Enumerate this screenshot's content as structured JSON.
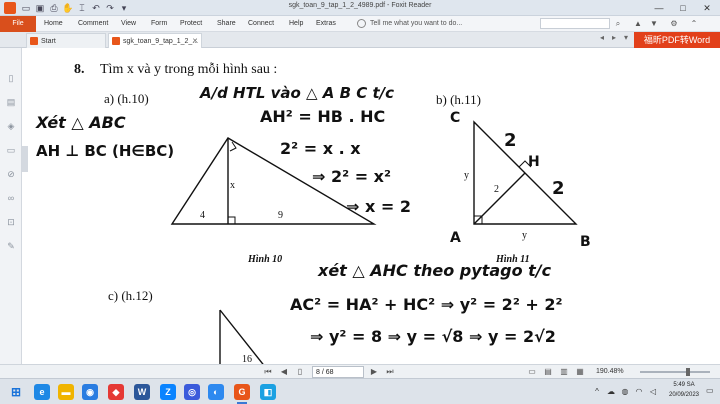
{
  "window": {
    "title": "sgk_toan_9_tap_1_2_4989.pdf - Foxit Reader",
    "minimize": "—",
    "maximize": "□",
    "close": "✕"
  },
  "menu": {
    "file": "File",
    "items": [
      "Home",
      "Comment",
      "View",
      "Form",
      "Protect",
      "Share",
      "Connect",
      "Help",
      "Extras"
    ],
    "tell_me": "Tell me what you want to do..."
  },
  "tabs": [
    {
      "label": "Start"
    },
    {
      "label": "sgk_toan_9_tap_1_2_..."
    }
  ],
  "promo": {
    "label": "福昕PDF转Word"
  },
  "document": {
    "exercise_number": "8.",
    "exercise_text": "Tìm x và y trong mỗi hình sau :",
    "part_a": "a) (h.10)",
    "part_b": "b) (h.11)",
    "part_c": "c) (h.12)",
    "fig10_caption": "Hình 10",
    "fig11_caption": "Hình 11",
    "fig10_labels": {
      "x": "x",
      "left": "4",
      "right": "9"
    },
    "fig11_labels": {
      "y_left": "y",
      "inner": "2",
      "y_bottom": "y"
    },
    "fig12_labels": {
      "value": "16"
    },
    "handwriting": {
      "top_header": "A/d HTL vào △ A B C t/c",
      "left_line1": "Xét △ ABC",
      "left_line2": "AH ⊥ BC (H∈BC)",
      "eq1": "AH² = HB . HC",
      "eq2": "2² = x . x",
      "eq3": "⇒ 2² = x²",
      "eq4": "⇒ x = 2",
      "fig11_C": "C",
      "fig11_H": "H",
      "fig11_A": "A",
      "fig11_B": "B",
      "fig11_two_top": "2",
      "fig11_two_right": "2",
      "mid_header": "xét △ AHC theo pytago t/c",
      "line_a": "AC² = HA² + HC² ⇒ y² = 2² + 2²",
      "line_b": "⇒ y² = 8 ⇒ y = √8 ⇒ y = 2√2"
    }
  },
  "status": {
    "page": "8 / 68",
    "zoom": "190.48%"
  },
  "taskbar": {
    "time": "5:49 SA",
    "date": "20/09/2023"
  }
}
